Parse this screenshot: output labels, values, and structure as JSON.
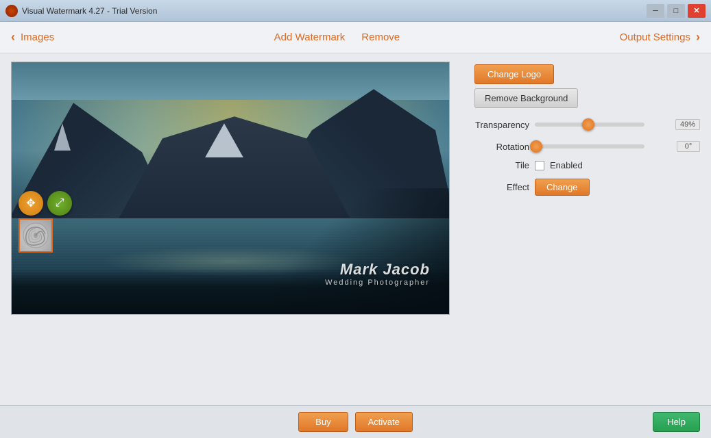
{
  "titleBar": {
    "title": "Visual Watermark 4.27 - Trial Version",
    "minBtn": "─",
    "maxBtn": "□",
    "closeBtn": "✕"
  },
  "nav": {
    "backArrow": "‹",
    "imagesLabel": "Images",
    "addWatermarkLabel": "Add Watermark",
    "removeLabel": "Remove",
    "outputSettingsLabel": "Output Settings",
    "forwardArrow": "›"
  },
  "rightPanel": {
    "changeLogoLabel": "Change Logo",
    "removeBgLabel": "Remove Background",
    "transparencyLabel": "Transparency",
    "transparencyValue": "49%",
    "transparencyPercent": 49,
    "rotationLabel": "Rotation",
    "rotationValue": "0°",
    "rotationPercent": 0,
    "tileLabel": "Tile",
    "tileEnabledLabel": "Enabled",
    "effectLabel": "Effect",
    "changeEffectLabel": "Change"
  },
  "watermark": {
    "firstName": "Mark",
    "lastName": "Jacob",
    "subtitle": "Wedding Photographer"
  },
  "overlayControls": {
    "moveIcon": "✥",
    "resizeIcon": "⤢"
  },
  "bottomBar": {
    "buyLabel": "Buy",
    "activateLabel": "Activate",
    "helpLabel": "Help"
  }
}
